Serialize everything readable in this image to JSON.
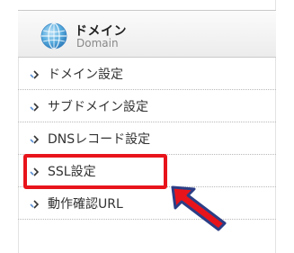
{
  "header": {
    "title": "ドメイン",
    "subtitle": "Domain",
    "icon": "globe-icon"
  },
  "menu": {
    "items": [
      {
        "label": "ドメイン設定",
        "icon": "chevron-right-icon"
      },
      {
        "label": "サブドメイン設定",
        "icon": "chevron-right-icon"
      },
      {
        "label": "DNSレコード設定",
        "icon": "chevron-right-icon"
      },
      {
        "label": "SSL設定",
        "icon": "chevron-right-icon",
        "highlighted": true
      },
      {
        "label": "動作確認URL",
        "icon": "chevron-right-icon"
      }
    ]
  },
  "annotation": {
    "highlight_color": "#e8141b",
    "arrow_fill": "#e8141b",
    "arrow_outline": "#2b3e86"
  },
  "colors": {
    "header_bg_top": "#fbfbfb",
    "header_bg_bottom": "#ececec",
    "item_text": "#333333",
    "arrow_icon_blue": "#5b8fd4"
  }
}
